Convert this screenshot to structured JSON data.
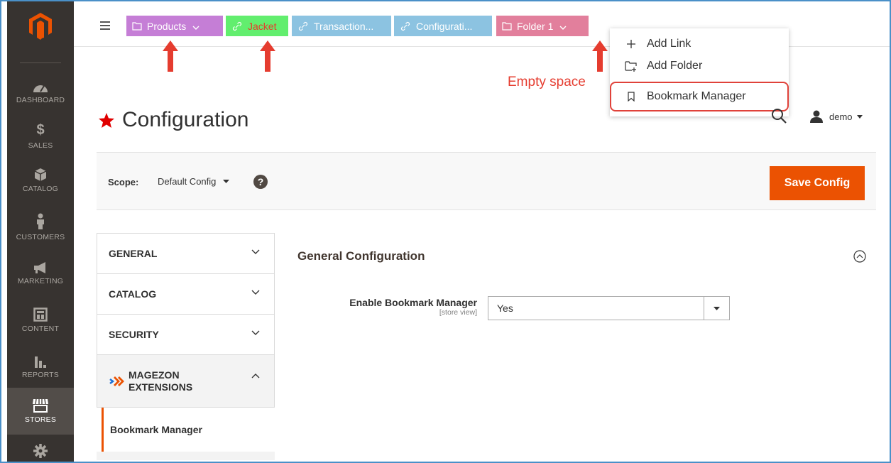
{
  "sidebar": {
    "items": [
      {
        "label": "DASHBOARD",
        "icon": "dashboard-icon"
      },
      {
        "label": "SALES",
        "icon": "dollar-icon"
      },
      {
        "label": "CATALOG",
        "icon": "box-icon"
      },
      {
        "label": "CUSTOMERS",
        "icon": "person-icon"
      },
      {
        "label": "MARKETING",
        "icon": "megaphone-icon"
      },
      {
        "label": "CONTENT",
        "icon": "layout-icon"
      },
      {
        "label": "REPORTS",
        "icon": "bar-chart-icon"
      },
      {
        "label": "STORES",
        "icon": "storefront-icon"
      },
      {
        "label": "",
        "icon": "gear-icon"
      }
    ]
  },
  "bookmarks": {
    "products": "Products",
    "jacket": "Jacket",
    "transactions": "Transaction...",
    "configuration": "Configurati...",
    "folder": "Folder 1"
  },
  "dropdown": {
    "add_link": "Add Link",
    "add_folder": "Add Folder",
    "bookmark_manager": "Bookmark Manager"
  },
  "annotation": {
    "empty_space": "Empty space",
    "color": "#e53c2f"
  },
  "header": {
    "title": "Configuration",
    "user": "demo"
  },
  "scope": {
    "label": "Scope:",
    "value": "Default Config",
    "help": "?",
    "save": "Save Config"
  },
  "tabs": {
    "general": "GENERAL",
    "catalog": "CATALOG",
    "security": "SECURITY",
    "magezon_line1": "MAGEZON",
    "magezon_line2": "EXTENSIONS",
    "bookmark_manager": "Bookmark Manager"
  },
  "content": {
    "section_title": "General Configuration",
    "field_label": "Enable Bookmark Manager",
    "field_scope": "[store view]",
    "field_value": "Yes"
  },
  "colors": {
    "accent": "#eb5202",
    "sidebar": "#373330"
  }
}
